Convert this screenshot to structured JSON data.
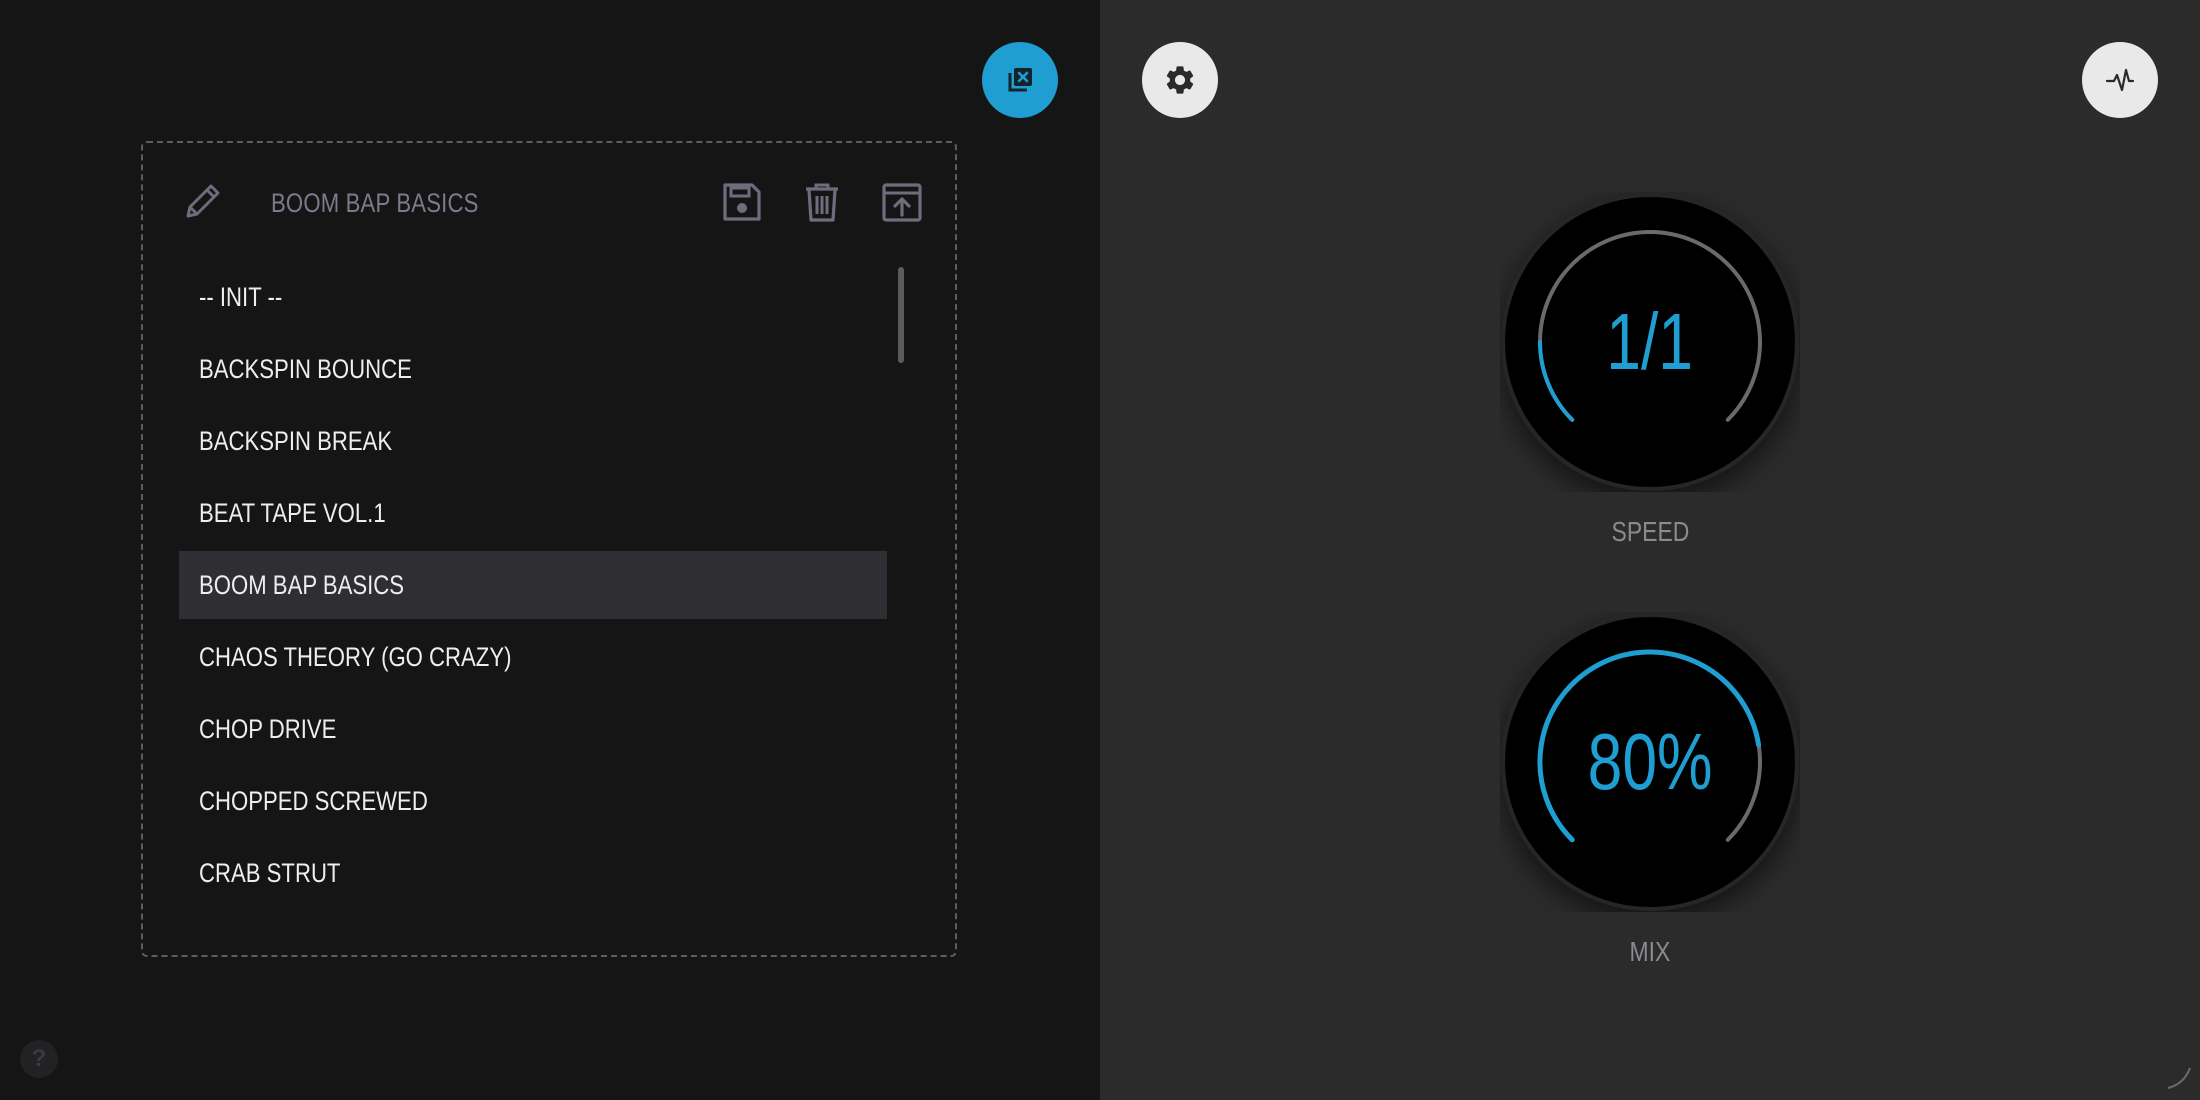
{
  "preset_panel": {
    "current_preset": "BOOM BAP BASICS",
    "items": [
      {
        "label": "-- INIT --"
      },
      {
        "label": "BACKSPIN BOUNCE"
      },
      {
        "label": "BACKSPIN BREAK"
      },
      {
        "label": "BEAT TAPE VOL.1"
      },
      {
        "label": "BOOM BAP BASICS",
        "selected": true
      },
      {
        "label": "CHAOS THEORY (GO CRAZY)"
      },
      {
        "label": "CHOP DRIVE"
      },
      {
        "label": "CHOPPED SCREWED"
      },
      {
        "label": "CRAB STRUT"
      }
    ]
  },
  "knobs": {
    "speed": {
      "label": "SPEED",
      "value_text": "1/1"
    },
    "mix": {
      "label": "MIX",
      "value_text": "80%",
      "value_fraction": 0.8
    }
  },
  "help": {
    "glyph": "?"
  },
  "colors": {
    "accent": "#1f9ed1",
    "panel_bg": "#151516",
    "main_bg": "#2b2b2c",
    "text": "#eeeef0",
    "muted": "#7d7a8c"
  }
}
